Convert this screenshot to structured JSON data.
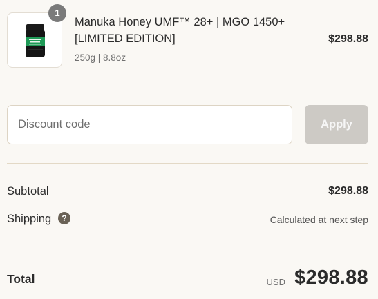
{
  "product": {
    "quantity": "1",
    "title": "Manuka Honey UMF™ 28+ | MGO 1450+ [LIMITED EDITION]",
    "variant": "250g | 8.8oz",
    "price": "$298.88",
    "image_icon": "honey-jar-icon"
  },
  "discount": {
    "placeholder": "Discount code",
    "apply_label": "Apply"
  },
  "summary": {
    "subtotal_label": "Subtotal",
    "subtotal_value": "$298.88",
    "shipping_label": "Shipping",
    "shipping_help_icon": "question-icon",
    "shipping_value": "Calculated at next step",
    "total_label": "Total",
    "currency": "USD",
    "total_value": "$298.88"
  },
  "colors": {
    "background": "#faf8f4",
    "divider": "#e3d9c6",
    "apply_disabled": "#cdcac5",
    "badge": "#7a7a7a",
    "help_icon": "#6a6256"
  }
}
